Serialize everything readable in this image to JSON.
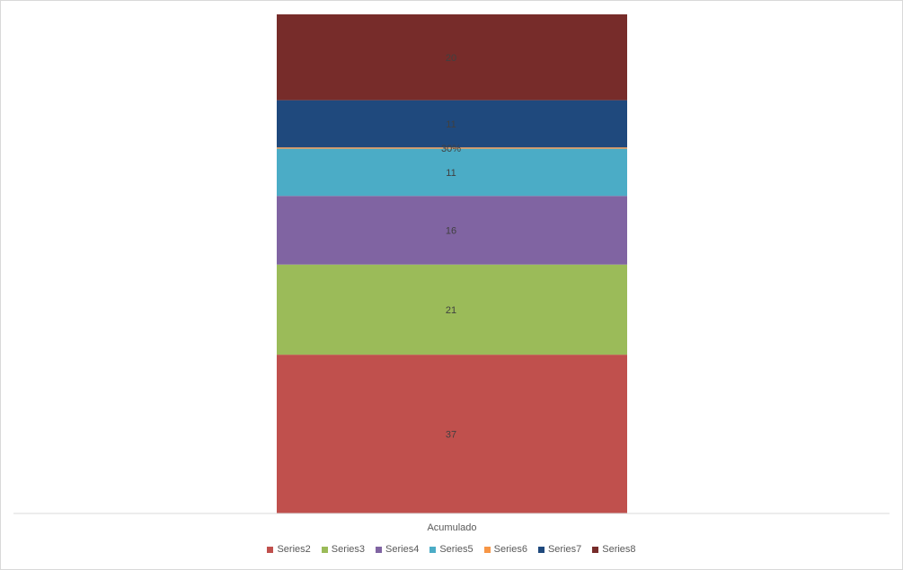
{
  "chart_data": {
    "type": "bar",
    "stacked": true,
    "categories": [
      "Acumulado"
    ],
    "series": [
      {
        "name": "Series2",
        "values": [
          37
        ],
        "label": "37",
        "color": "#C0504D"
      },
      {
        "name": "Series3",
        "values": [
          21
        ],
        "label": "21",
        "color": "#9BBB59"
      },
      {
        "name": "Series4",
        "values": [
          16
        ],
        "label": "16",
        "color": "#8064A2"
      },
      {
        "name": "Series5",
        "values": [
          11
        ],
        "label": "11",
        "color": "#4BACC6"
      },
      {
        "name": "Series6",
        "values": [
          0.3
        ],
        "label": "30%",
        "color": "#F79646"
      },
      {
        "name": "Series7",
        "values": [
          11
        ],
        "label": "11",
        "color": "#1F497D"
      },
      {
        "name": "Series8",
        "values": [
          20
        ],
        "label": "20",
        "color": "#772C2A"
      }
    ],
    "ylim": [
      0,
      116.3
    ],
    "title": "",
    "xlabel": "",
    "ylabel": "",
    "grid": false,
    "legend_position": "bottom"
  }
}
